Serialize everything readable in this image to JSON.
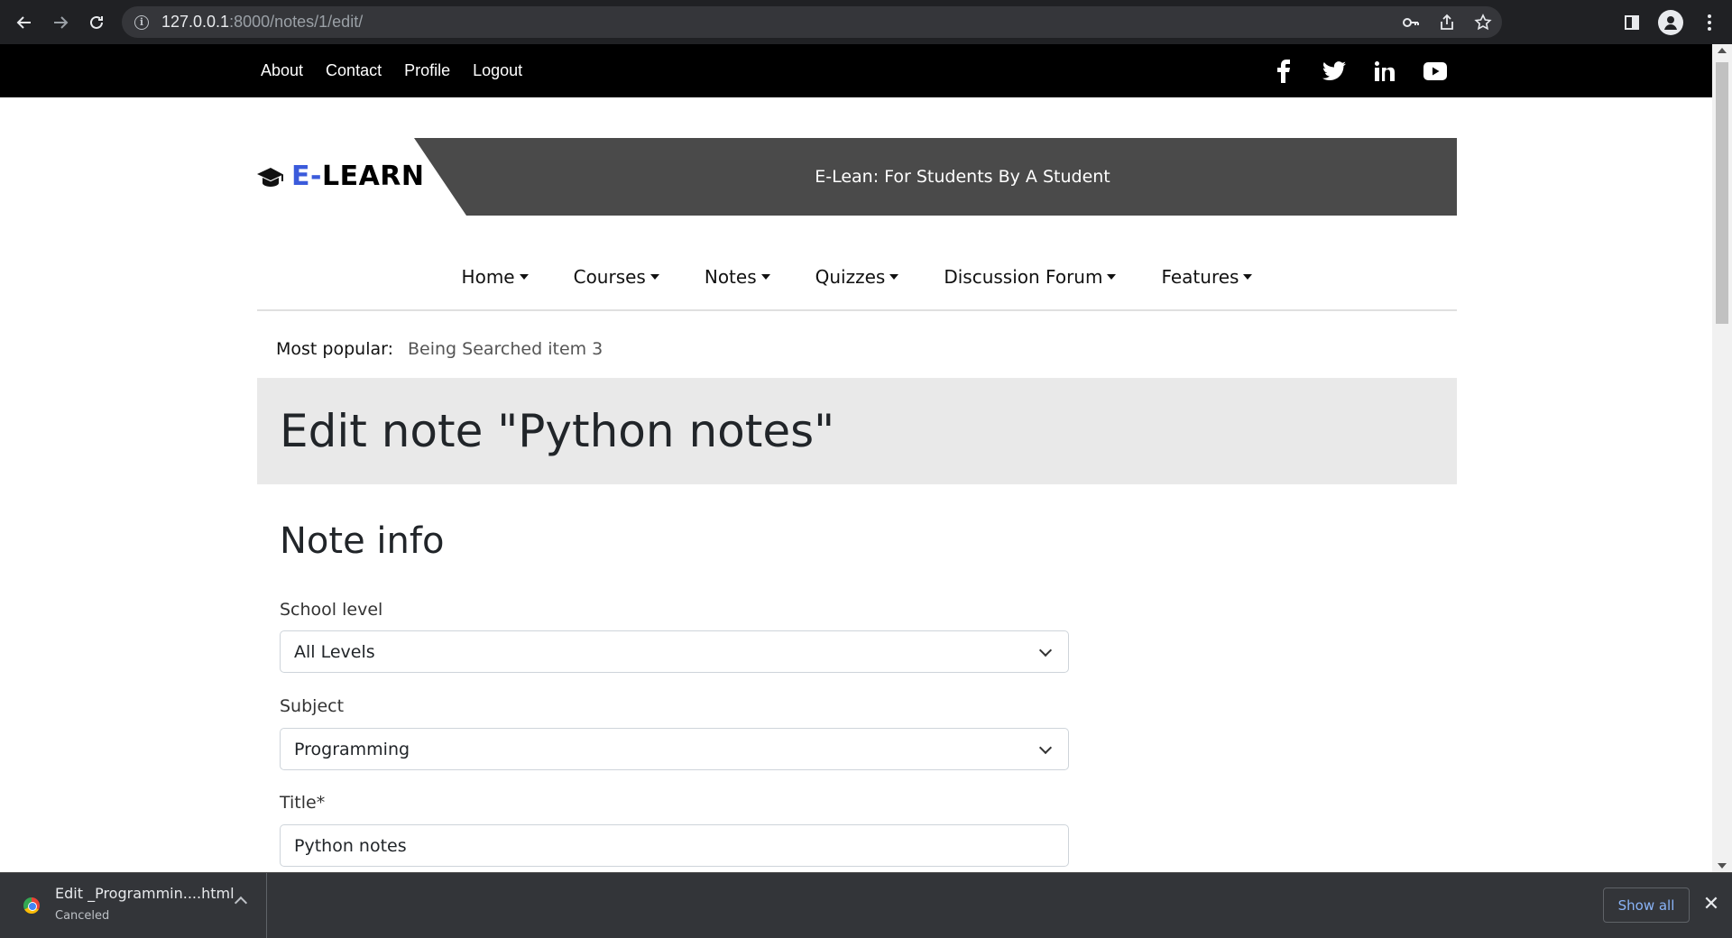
{
  "browser": {
    "url_host": "127.0.0.1",
    "url_path": ":8000/notes/1/edit/"
  },
  "topbar": {
    "links": [
      "About",
      "Contact",
      "Profile",
      "Logout"
    ],
    "social_icons": [
      "facebook-icon",
      "twitter-icon",
      "linkedin-icon",
      "youtube-icon"
    ]
  },
  "header": {
    "brand_prefix": "E-",
    "brand_suffix": "LEARN",
    "tagline": "E-Lean: For Students By A Student",
    "brand_accent": "#3b5bdb"
  },
  "nav": {
    "items": [
      "Home",
      "Courses",
      "Notes",
      "Quizzes",
      "Discussion Forum",
      "Features"
    ]
  },
  "popular": {
    "label": "Most popular:",
    "value": "Being Searched item 3"
  },
  "page": {
    "title": "Edit note \"Python notes\"",
    "section_title": "Note info"
  },
  "form": {
    "school_level_label": "School level",
    "school_level_value": "All Levels",
    "subject_label": "Subject",
    "subject_value": "Programming",
    "title_label": "Title*",
    "title_value": "Python notes"
  },
  "download_shelf": {
    "filename": "Edit _Programmin....html",
    "status": "Canceled",
    "show_all": "Show all"
  }
}
